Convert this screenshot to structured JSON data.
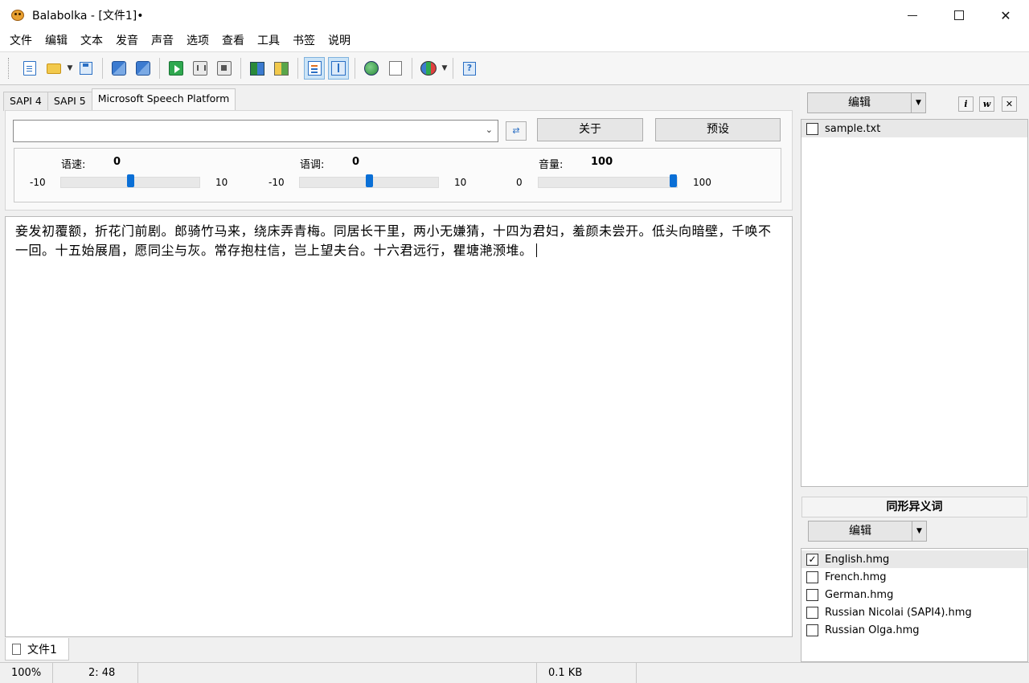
{
  "window": {
    "title": "Balabolka - [文件1]•",
    "minimize": "—",
    "close": "✕"
  },
  "menu": [
    "文件",
    "编辑",
    "文本",
    "发音",
    "声音",
    "选项",
    "查看",
    "工具",
    "书签",
    "说明"
  ],
  "toolbar": {
    "icons": [
      "new-document-icon",
      "open-folder-icon",
      "save-icon",
      "save-audio-icon",
      "save-audio-split-icon",
      "play-icon",
      "pause-icon",
      "stop-icon",
      "read-clipboard-icon",
      "open-book-icon",
      "text-list-icon",
      "split-view-icon",
      "spell-check-icon",
      "page-icon",
      "voices-icon",
      "help-icon"
    ],
    "help_label": "?"
  },
  "engine_tabs": [
    "SAPI 4",
    "SAPI 5",
    "Microsoft Speech Platform"
  ],
  "voice": {
    "selected": "",
    "swap_glyph": "⇄",
    "about_label": "关于",
    "presets_label": "预设",
    "rate": {
      "label": "语速:",
      "value": "0",
      "min": "-10",
      "max": "10",
      "position": 0.5
    },
    "pitch": {
      "label": "语调:",
      "value": "0",
      "min": "-10",
      "max": "10",
      "position": 0.5
    },
    "volume": {
      "label": "音量:",
      "value": "100",
      "min": "0",
      "max": "100",
      "position": 1.0
    }
  },
  "editor": {
    "text": "妾发初覆额，折花门前剧。郎骑竹马来，绕床弄青梅。同居长干里，两小无嫌猜，十四为君妇，羞颜未尝开。低头向暗壁，千唤不一回。十五始展眉，愿同尘与灰。常存抱柱信，岂上望夫台。十六君远行，瞿塘滟滪堆。"
  },
  "doc_tab": {
    "label": "文件1"
  },
  "right_panel": {
    "edit_label": "编辑",
    "info_label": "i",
    "w_label": "w",
    "close_label": "✕",
    "files": [
      {
        "name": "sample.txt",
        "checked": false
      }
    ],
    "homograph_header": "同形异义词",
    "homograph_edit_label": "编辑",
    "homographs": [
      {
        "name": "English.hmg",
        "checked": true
      },
      {
        "name": "French.hmg",
        "checked": false
      },
      {
        "name": "German.hmg",
        "checked": false
      },
      {
        "name": "Russian Nicolai (SAPI4).hmg",
        "checked": false
      },
      {
        "name": "Russian Olga.hmg",
        "checked": false
      }
    ]
  },
  "status": {
    "zoom": "100%",
    "position": "2:  48",
    "size": "0.1 KB"
  }
}
